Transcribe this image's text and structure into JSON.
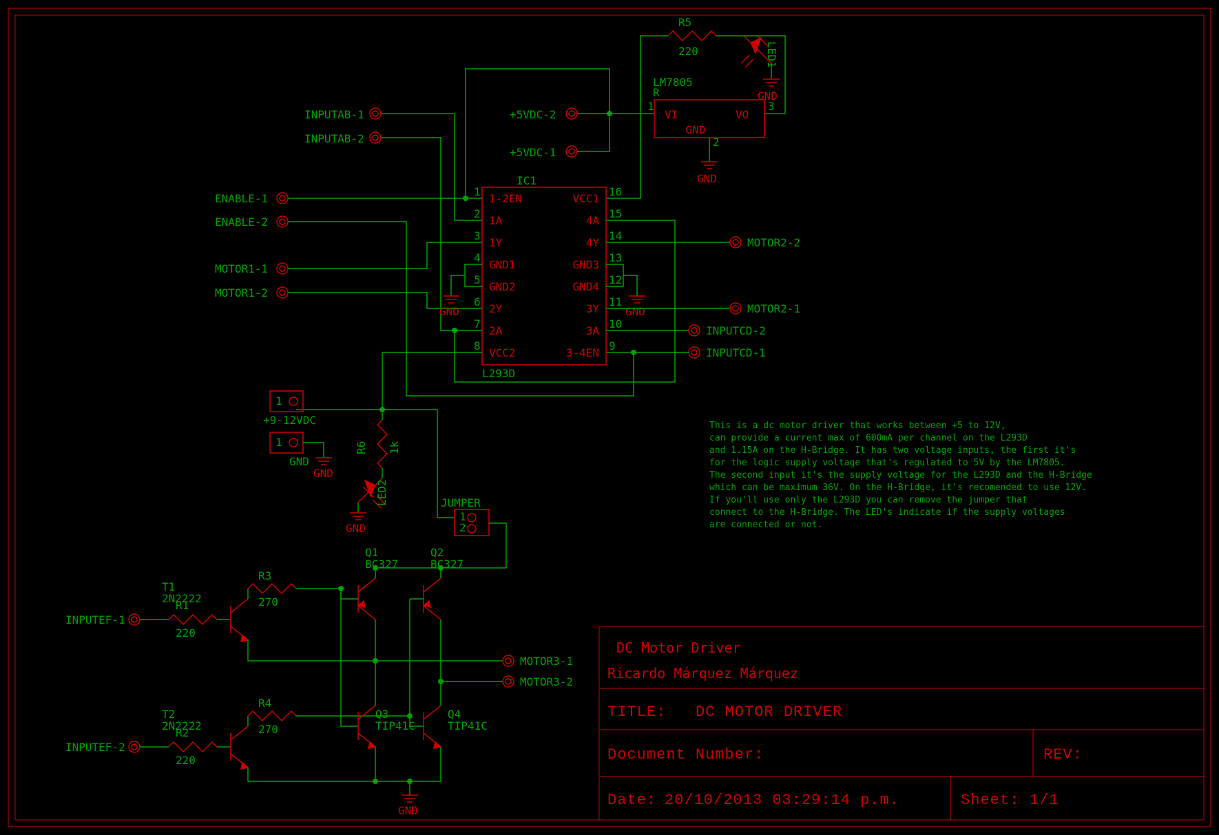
{
  "components": {
    "R5": {
      "name": "R5",
      "value": "220"
    },
    "R6": {
      "name": "R6",
      "value": "1k"
    },
    "R1": {
      "name": "R1",
      "value": "220"
    },
    "R2": {
      "name": "R2",
      "value": "220"
    },
    "R3": {
      "name": "R3",
      "value": "270"
    },
    "R4": {
      "name": "R4",
      "value": "270"
    },
    "LED1": {
      "name": "LED1"
    },
    "LED2": {
      "name": "LED2"
    },
    "R": {
      "name": "R",
      "value": "LM7805",
      "pins": {
        "vi": "VI",
        "vo": "VO",
        "gnd": "GND"
      }
    },
    "IC1": {
      "name": "IC1",
      "value": "L293D",
      "pins": {
        "1": "1-2EN",
        "2": "1A",
        "3": "1Y",
        "4": "GND1",
        "5": "GND2",
        "6": "2Y",
        "7": "2A",
        "8": "VCC2",
        "9": "3-4EN",
        "10": "3A",
        "11": "3Y",
        "12": "GND4",
        "13": "GND3",
        "14": "4Y",
        "15": "4A",
        "16": "VCC1"
      }
    },
    "Q1": {
      "name": "Q1",
      "value": "BC327"
    },
    "Q2": {
      "name": "Q2",
      "value": "BC327"
    },
    "Q3": {
      "name": "Q3",
      "value": "TIP41C"
    },
    "Q4": {
      "name": "Q4",
      "value": "TIP41C"
    },
    "T1": {
      "name": "T1",
      "value": "2N2222"
    },
    "T2": {
      "name": "T2",
      "value": "2N2222"
    },
    "JUMPER": {
      "name": "JUMPER"
    }
  },
  "power": {
    "p912": "+9-12VDC",
    "gnd": "GND"
  },
  "nets": {
    "5vdc1": "+5VDC-1",
    "5vdc2": "+5VDC-2",
    "inputab1": "INPUTAB-1",
    "inputab2": "INPUTAB-2",
    "enable1": "ENABLE-1",
    "enable2": "ENABLE-2",
    "motor11": "MOTOR1-1",
    "motor12": "MOTOR1-2",
    "motor21": "MOTOR2-1",
    "motor22": "MOTOR2-2",
    "motor31": "MOTOR3-1",
    "motor32": "MOTOR3-2",
    "inputcd1": "INPUTCD-1",
    "inputcd2": "INPUTCD-2",
    "inputef1": "INPUTEF-1",
    "inputef2": "INPUTEF-2"
  },
  "description": [
    "This is a dc motor driver that works between +5 to 12V,",
    "can provide a current max of 600mA per channel on the L293D",
    " and 1.15A on the H-Bridge. It has two voltage inputs, the first it's",
    " for the logic supply voltage that's regulated to 5V by the LM7805.",
    "The second input it's the supply voltage for the L293D and the H-Bridge",
    " which can be maximum 36V. On the H-Bridge, it's recomended to use 12V.",
    "If you'll use only the L293D you can remove the jumper that",
    "connect to the H-Bridge. The LED's indicate if the supply voltages",
    "are connected or not."
  ],
  "titleblock": {
    "project": "DC Motor Driver",
    "author": "Ricardo Márquez Márquez",
    "title_label": "TITLE:",
    "title": "DC MOTOR DRIVER",
    "docnum_label": "Document Number:",
    "rev_label": "REV:",
    "date_label": "Date:",
    "date": "20/10/2013 03:29:14 p.m.",
    "sheet_label": "Sheet:",
    "sheet": "1/1"
  },
  "gnd_label": "GND",
  "pin_nums": {
    "1": "1",
    "2": "2",
    "3": "3"
  }
}
